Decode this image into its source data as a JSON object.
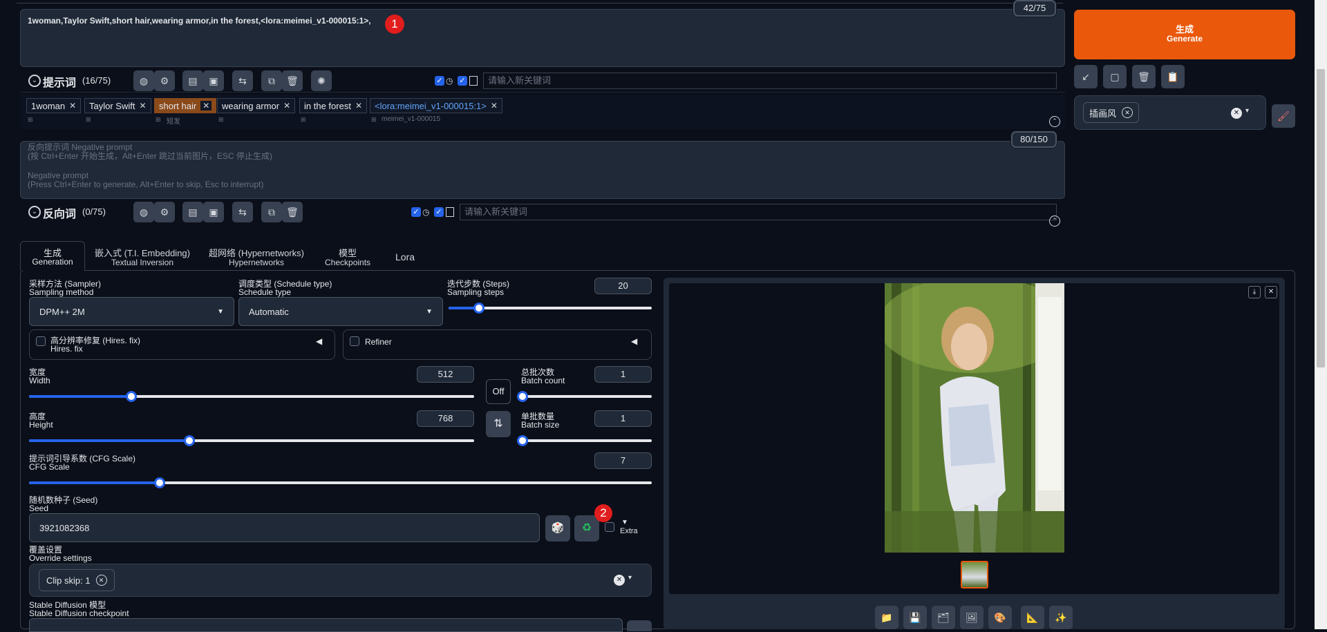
{
  "prompt": {
    "text": "1woman,Taylor Swift,short hair,wearing armor,in the forest,<lora:meimei_v1-000015:1>,",
    "counter": "42/75",
    "badge": "1"
  },
  "prompt_bar": {
    "title": "提示词",
    "count": "(16/75)",
    "keyword_placeholder": "请输入新关键词"
  },
  "tags": [
    {
      "label": "1woman",
      "sub": ""
    },
    {
      "label": "Taylor Swift",
      "sub": ""
    },
    {
      "label": "short hair",
      "sub": "短发"
    },
    {
      "label": "wearing armor",
      "sub": ""
    },
    {
      "label": "in the forest",
      "sub": ""
    },
    {
      "label": "<lora:meimei_v1-000015:1>",
      "sub": "meimei_v1-000015"
    }
  ],
  "negative": {
    "line1": "反向提示词 Negative prompt",
    "line2": "(按 Ctrl+Enter 开始生成，Alt+Enter 跳过当前图片，ESC 停止生成)",
    "line3": "Negative prompt",
    "line4": "(Press Ctrl+Enter to generate, Alt+Enter to skip, Esc to interrupt)",
    "counter": "80/150"
  },
  "negative_bar": {
    "title": "反向词",
    "count": "(0/75)",
    "keyword_placeholder": "请输入新关键词"
  },
  "generate": {
    "zh": "生成",
    "en": "Generate"
  },
  "style": {
    "chip": "插画风"
  },
  "tabs": [
    {
      "zh": "生成",
      "en": "Generation"
    },
    {
      "zh": "嵌入式 (T.I. Embedding)",
      "en": "Textual Inversion"
    },
    {
      "zh": "超网络 (Hypernetworks)",
      "en": "Hypernetworks"
    },
    {
      "zh": "模型",
      "en": "Checkpoints"
    },
    {
      "zh": "Lora",
      "en": ""
    }
  ],
  "sampler": {
    "zh": "采样方法 (Sampler)",
    "en": "Sampling method",
    "value": "DPM++ 2M"
  },
  "schedule": {
    "zh": "调度类型 (Schedule type)",
    "en": "Schedule type",
    "value": "Automatic"
  },
  "steps": {
    "zh": "迭代步数 (Steps)",
    "en": "Sampling steps",
    "value": "20",
    "fraction": 0.15
  },
  "hires": {
    "zh": "高分辨率修复 (Hires. fix)",
    "en": "Hires. fix"
  },
  "refiner": {
    "label": "Refiner"
  },
  "width": {
    "zh": "宽度",
    "en": "Width",
    "value": "512",
    "fraction": 0.23
  },
  "height": {
    "zh": "高度",
    "en": "Height",
    "value": "768",
    "fraction": 0.36
  },
  "off_btn": "Off",
  "batch_count": {
    "zh": "总批次数",
    "en": "Batch count",
    "value": "1",
    "fraction": 0.0
  },
  "batch_size": {
    "zh": "单批数量",
    "en": "Batch size",
    "value": "1",
    "fraction": 0.0
  },
  "cfg": {
    "zh": "提示词引导系数 (CFG Scale)",
    "en": "CFG Scale",
    "value": "7",
    "fraction": 0.21
  },
  "seed": {
    "zh": "随机数种子 (Seed)",
    "en": "Seed",
    "value": "3921082368",
    "badge": "2",
    "extra": "Extra"
  },
  "override": {
    "zh": "覆盖设置",
    "en": "Override settings",
    "chip": "Clip skip: 1"
  },
  "checkpoint": {
    "zh": "Stable Diffusion 模型",
    "en": "Stable Diffusion checkpoint"
  },
  "colors": {
    "accent": "#ea580c",
    "blue": "#2563eb",
    "badge": "#e11d1d"
  }
}
